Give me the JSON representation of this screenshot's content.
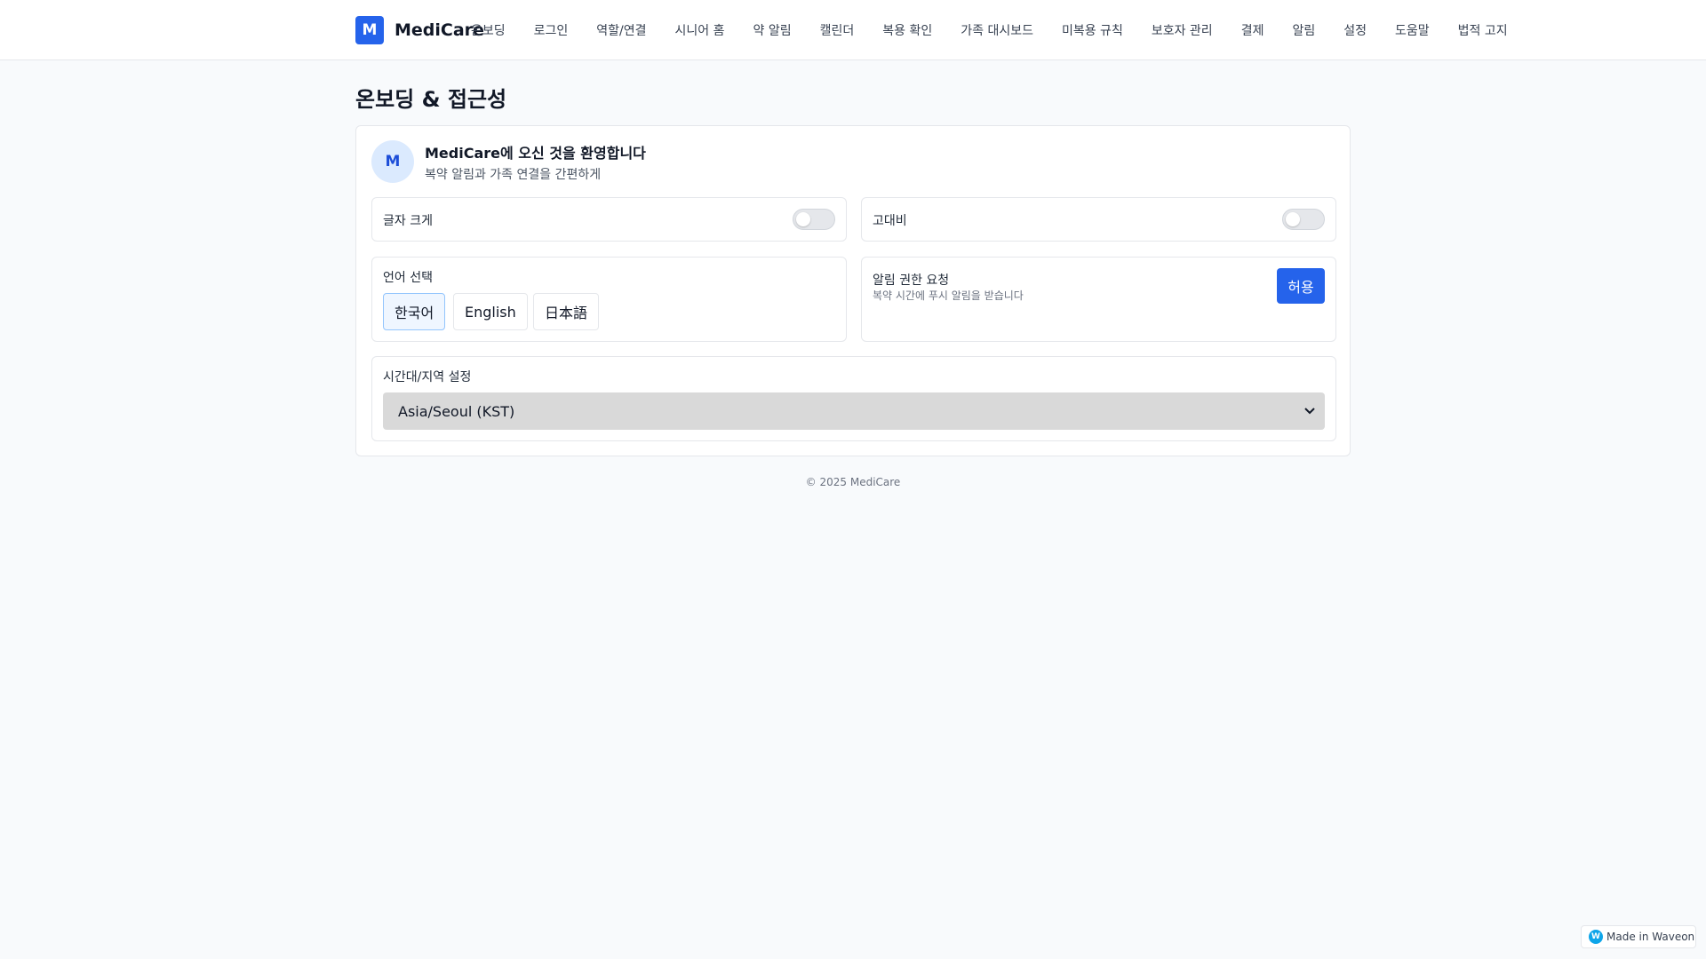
{
  "header": {
    "logo_letter": "M",
    "brand": "MediCare",
    "nav": [
      {
        "label": "온보딩"
      },
      {
        "label": "로그인"
      },
      {
        "label": "역할/연결"
      },
      {
        "label": "시니어 홈"
      },
      {
        "label": "약 알림"
      },
      {
        "label": "캘린더"
      },
      {
        "label": "복용 확인"
      },
      {
        "label": "가족 대시보드"
      },
      {
        "label": "미복용 규칙"
      },
      {
        "label": "보호자 관리"
      },
      {
        "label": "결제"
      },
      {
        "label": "알림"
      },
      {
        "label": "설정"
      },
      {
        "label": "도움말"
      },
      {
        "label": "법적 고지"
      }
    ]
  },
  "page": {
    "title": "온보딩 & 접근성"
  },
  "welcome": {
    "avatar": "M",
    "title": "MediCare에 오신 것을 환영합니다",
    "subtitle": "복약 알림과 가족 연결을 간편하게"
  },
  "settings": {
    "font_size": {
      "label": "글자 크게",
      "enabled": false
    },
    "high_contrast": {
      "label": "고대비",
      "enabled": false
    },
    "language": {
      "label": "언어 선택",
      "options": [
        "한국어",
        "English",
        "日本語"
      ],
      "selected": "한국어"
    },
    "notification": {
      "label": "알림 권한 요청",
      "description": "복약 시간에 푸시 알림을 받습니다",
      "button": "허용"
    },
    "timezone": {
      "label": "시간대/지역 설정",
      "value": "Asia/Seoul (KST)"
    }
  },
  "footer": {
    "text": "© 2025 MediCare"
  },
  "badge": {
    "icon_letter": "W",
    "text": "Made in Waveon"
  },
  "colors": {
    "accent": "#2563eb",
    "background": "#f8fafc"
  }
}
